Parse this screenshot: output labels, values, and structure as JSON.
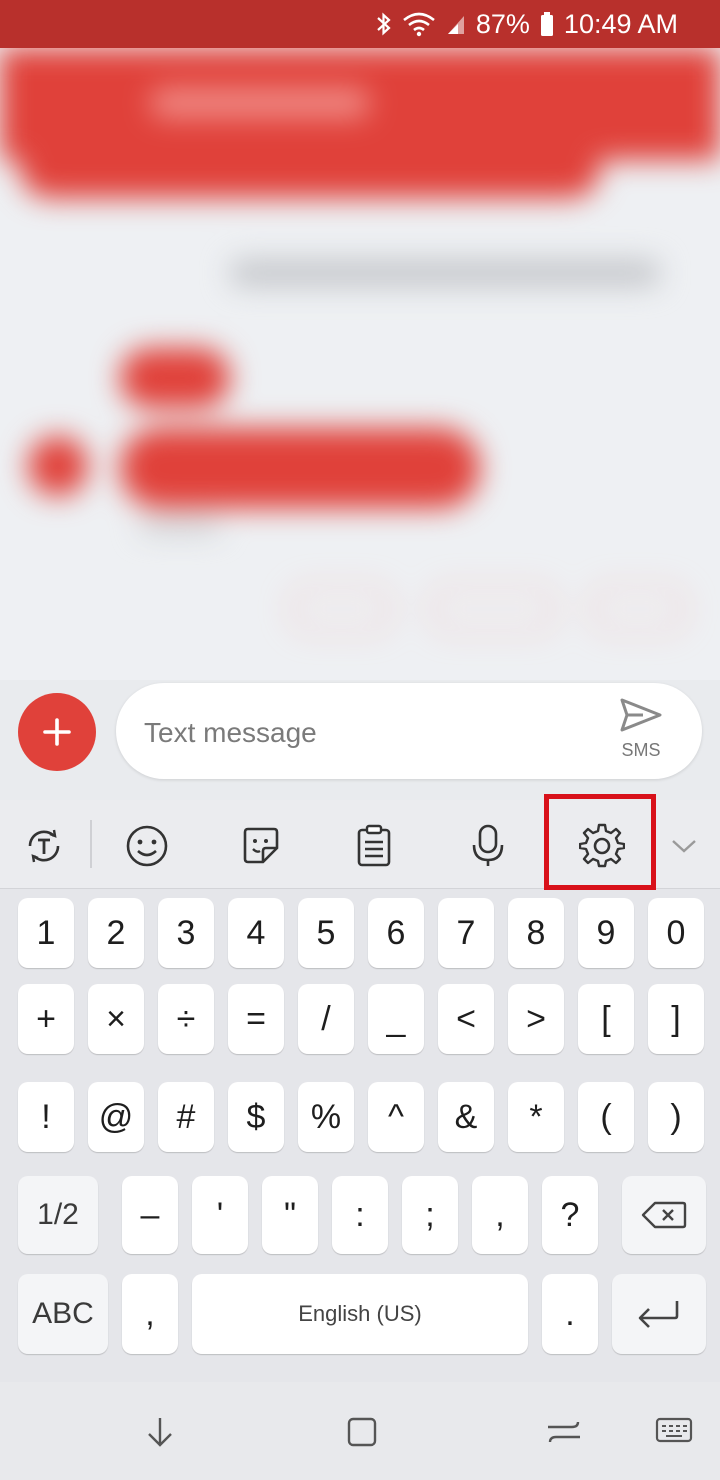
{
  "status_bar": {
    "battery": "87%",
    "time": "10:49 AM",
    "icons": [
      "bluetooth-icon",
      "wifi-icon",
      "signal-icon",
      "battery-icon"
    ]
  },
  "composer": {
    "placeholder": "Text message",
    "send_label": "SMS"
  },
  "keyboard": {
    "toolbar": [
      "text-style-icon",
      "emoji-icon",
      "sticker-icon",
      "clipboard-icon",
      "mic-icon",
      "gear-icon",
      "chevron-down-icon"
    ],
    "row1": [
      "1",
      "2",
      "3",
      "4",
      "5",
      "6",
      "7",
      "8",
      "9",
      "0"
    ],
    "row2": [
      "+",
      "×",
      "÷",
      "=",
      "/",
      "_",
      "<",
      ">",
      "[",
      "]"
    ],
    "row3": [
      "!",
      "@",
      "#",
      "$",
      "%",
      "^",
      "&",
      "*",
      "(",
      ")"
    ],
    "row4": [
      "1/2",
      "–",
      "'",
      "\"",
      ":",
      ";",
      ",",
      "?"
    ],
    "row5": {
      "abc": "ABC",
      "comma": ",",
      "space": "English (US)",
      "period": "."
    }
  },
  "colors": {
    "accent": "#e0413a",
    "status_bar": "#b8302c",
    "highlight": "#d8111a"
  }
}
